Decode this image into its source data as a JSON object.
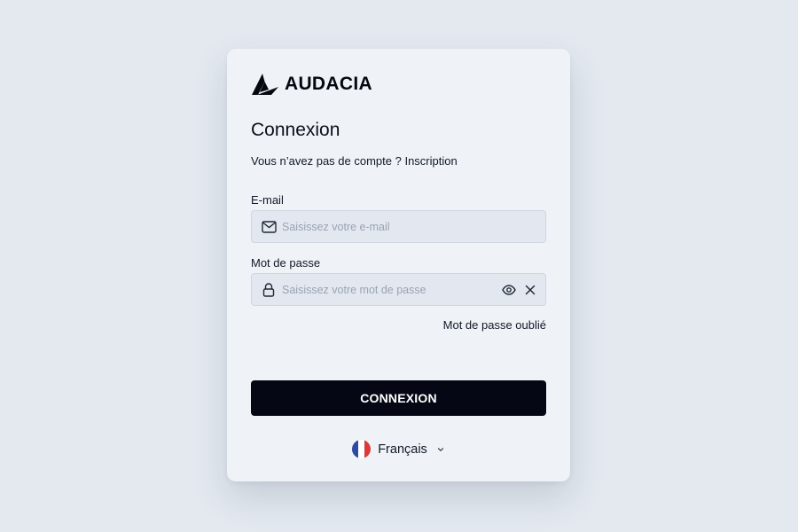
{
  "brand": {
    "name": "AUDACIA",
    "logo_icon": "audacia-logo-icon"
  },
  "login": {
    "title": "Connexion",
    "signup_prompt": "Vous n’avez pas de compte ?",
    "signup_link": "Inscription",
    "email": {
      "label": "E-mail",
      "value": "",
      "placeholder": "Saisissez votre e-mail",
      "icon": "envelope-icon"
    },
    "password": {
      "label": "Mot de passe",
      "value": "",
      "placeholder": "Saisissez votre mot de passe",
      "icon": "lock-icon",
      "show_icon": "eye-icon",
      "clear_icon": "close-icon"
    },
    "forgot_password": "Mot de passe oublié",
    "submit_label": "CONNEXION"
  },
  "language": {
    "selected": "Français",
    "flag_icon": "france-flag-icon",
    "dropdown_icon": "chevron-down-icon"
  },
  "colors": {
    "page_background": "#e4e9f0",
    "card_background": "#eff3f8",
    "input_background": "#e3e8f0",
    "button_background": "#050814",
    "button_text": "#ffffff",
    "flag_blue": "#2f4aa3",
    "flag_red": "#d93b3b"
  }
}
